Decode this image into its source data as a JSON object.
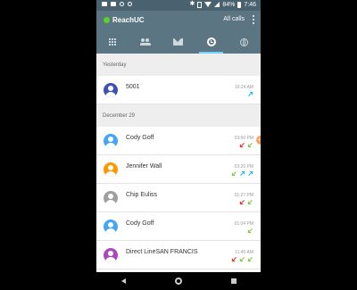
{
  "status_bar": {
    "battery": "84%",
    "time": "7:46"
  },
  "header": {
    "app_title": "ReachUC",
    "filter_label": "All calls"
  },
  "tabs": [
    {
      "icon": "dialpad-icon"
    },
    {
      "icon": "contacts-icon"
    },
    {
      "icon": "messages-icon"
    },
    {
      "icon": "history-icon",
      "active": true
    },
    {
      "icon": "globe-icon"
    }
  ],
  "sections": [
    {
      "title": "Yesterday",
      "calls": [
        {
          "name": "5001",
          "time": "10:24 AM",
          "avatar_color": "#3f51b5",
          "arrows": [
            "out-blue"
          ]
        }
      ]
    },
    {
      "title": "December 29",
      "calls": [
        {
          "name": "Cody Goff",
          "time": "03:50 PM",
          "avatar_color": "#42a5f5",
          "arrows": [
            "missed-red",
            "in-green"
          ]
        },
        {
          "name": "Jennifer Wall",
          "time": "03:20 PM",
          "avatar_color": "#ff9800",
          "arrows": [
            "in-green",
            "out-blue",
            "out-blue"
          ]
        },
        {
          "name": "Chip Euliss",
          "time": "01:27 PM",
          "avatar_color": "#9e9e9e",
          "arrows": [
            "missed-red",
            "in-green"
          ]
        },
        {
          "name": "Cody Goff",
          "time": "01:04 PM",
          "avatar_color": "#42a5f5",
          "arrows": [
            "in-green"
          ]
        },
        {
          "name": "Direct LineSAN FRANCIS",
          "time": "11:40 AM",
          "avatar_color": "#ab47bc",
          "arrows": [
            "missed-red",
            "in-green",
            "in-green"
          ]
        }
      ]
    }
  ],
  "colors": {
    "header": "#5b7582",
    "accent": "#6fd3f7",
    "online": "#5ad032",
    "missed": "#e53935",
    "incoming": "#8bc34a",
    "outgoing": "#29b6f6"
  }
}
